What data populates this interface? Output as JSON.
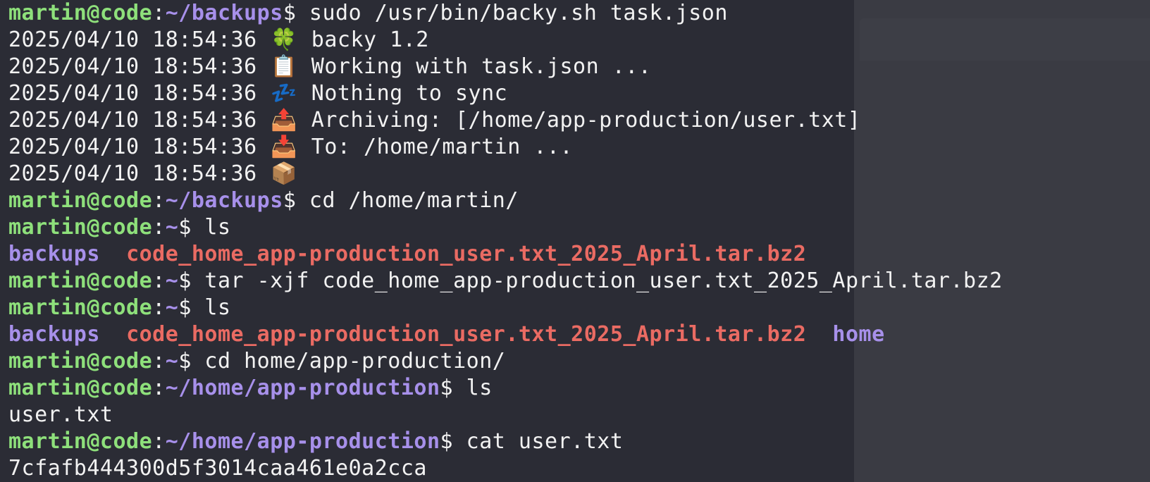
{
  "terminal": {
    "lines": [
      {
        "type": "prompt",
        "user": "martin@code",
        "path": "~/backups",
        "command": " sudo /usr/bin/backy.sh task.json"
      },
      {
        "type": "log",
        "timestamp": "2025/04/10 18:54:36",
        "emoji": "🍀",
        "message": "backy 1.2"
      },
      {
        "type": "log",
        "timestamp": "2025/04/10 18:54:36",
        "emoji": "📋",
        "message": "Working with task.json ..."
      },
      {
        "type": "log",
        "timestamp": "2025/04/10 18:54:36",
        "emoji": "💤",
        "message": "Nothing to sync"
      },
      {
        "type": "log",
        "timestamp": "2025/04/10 18:54:36",
        "emoji": "📤",
        "message": "Archiving: [/home/app-production/user.txt]"
      },
      {
        "type": "log",
        "timestamp": "2025/04/10 18:54:36",
        "emoji": "📥",
        "message": "To: /home/martin ..."
      },
      {
        "type": "log",
        "timestamp": "2025/04/10 18:54:36",
        "emoji": "📦",
        "message": ""
      },
      {
        "type": "prompt",
        "user": "martin@code",
        "path": "~/backups",
        "command": " cd /home/martin/"
      },
      {
        "type": "prompt",
        "user": "martin@code",
        "path": "~",
        "command": " ls"
      },
      {
        "type": "ls",
        "items": [
          {
            "kind": "dir",
            "name": "backups"
          },
          {
            "kind": "archive",
            "name": "code_home_app-production_user.txt_2025_April.tar.bz2"
          }
        ]
      },
      {
        "type": "prompt",
        "user": "martin@code",
        "path": "~",
        "command": " tar -xjf code_home_app-production_user.txt_2025_April.tar.bz2"
      },
      {
        "type": "prompt",
        "user": "martin@code",
        "path": "~",
        "command": " ls"
      },
      {
        "type": "ls",
        "items": [
          {
            "kind": "dir",
            "name": "backups"
          },
          {
            "kind": "archive",
            "name": "code_home_app-production_user.txt_2025_April.tar.bz2"
          },
          {
            "kind": "dir",
            "name": "home"
          }
        ]
      },
      {
        "type": "prompt",
        "user": "martin@code",
        "path": "~",
        "command": " cd home/app-production/"
      },
      {
        "type": "prompt",
        "user": "martin@code",
        "path": "~/home/app-production",
        "command": " ls"
      },
      {
        "type": "text",
        "text": "user.txt"
      },
      {
        "type": "prompt",
        "user": "martin@code",
        "path": "~/home/app-production",
        "command": " cat user.txt"
      },
      {
        "type": "text",
        "text": "7cfafb444300d5f3014caa461e0a2cca"
      }
    ]
  }
}
